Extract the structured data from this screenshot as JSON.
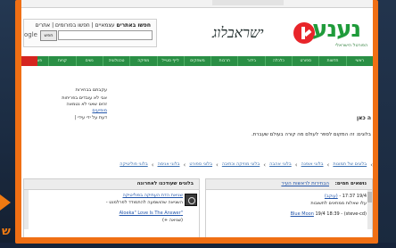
{
  "side": {
    "glyph": "ש"
  },
  "search": {
    "label_bold": "חפשו באתרים",
    "label_rest": " עצמאיים | חפשו בפורומים | אתרים",
    "placeholder": "",
    "button_label": "חפש",
    "provider": "ogle"
  },
  "logo": {
    "word": "נענע",
    "tagline": "ישראבלוג",
    "subtitle": "הפורטל הישראלי"
  },
  "nav": {
    "items": [
      "ראשי",
      "חדשות",
      "ספורט",
      "כלכלה",
      "בידור",
      "תרבות",
      "משחקים",
      "לייף סטייל",
      "מוזיקה",
      "טכנולוגיה",
      "נשים",
      "קניות",
      "פורומים"
    ]
  },
  "left_box": {
    "title": "עקבתם בבחירות",
    "line1": "אבי לא עובדים בפריחות",
    "line2": "זהים שאני לא נטמאה",
    "link": "מופיעים",
    "footer": "דעת על ידי עידי |"
  },
  "main": {
    "heading": "ה כאן",
    "subtitle": "בלוגים: זה המקום לספר לעולם מה קורה בעולם שעברת."
  },
  "breadcrumbs": [
    "בלוגים של תמונות",
    "בלוגי אופנה",
    "בלוגי אהבה",
    "בלוגי מוזיקה וכתיבה",
    "בלוגי ספורט",
    "בלוגי אנימה",
    "בלוגי פוליטיקה"
  ],
  "box_right": {
    "title": "נושאים חמים:",
    "title_link": "הבחירות לראשות העיר",
    "rows": [
      {
        "time": "19/4 17:37 -",
        "user": "(עוקב)",
        "text": "עלו שאלות ממתינים לתשובות"
      },
      {
        "time": "19/4 18:39 -",
        "user": "(steve-cd)",
        "link": "Blue Moon"
      }
    ]
  },
  "box_left": {
    "title": "בלוגים שעודכנו לאחרונה",
    "rows": [
      {
        "text": "שגיאת הדת העתיקה בפוליטיקה"
      },
      {
        "text": "השגיאה שהושמעה להתמודד לפרלמנט -"
      },
      {
        "text": "\"Aloeka\" Love Is The Answer",
        "link": "love is the answer"
      },
      {
        "text": "(שגיאה +)"
      }
    ]
  }
}
